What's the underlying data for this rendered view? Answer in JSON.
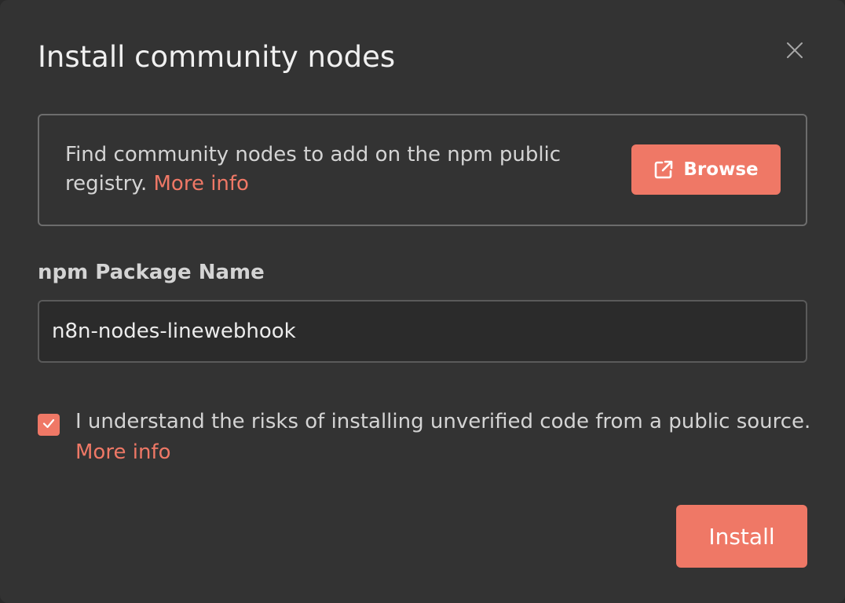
{
  "dialog": {
    "title": "Install community nodes"
  },
  "info": {
    "text": "Find community nodes to add on the npm public registry.",
    "more_info_label": "More info",
    "browse_label": "Browse"
  },
  "package_field": {
    "label": "npm Package Name",
    "value": "n8n-nodes-linewebhook"
  },
  "consent": {
    "checked": true,
    "text": "I understand the risks of installing unverified code from a public source.",
    "more_info_label": "More info"
  },
  "actions": {
    "install_label": "Install"
  },
  "icons": {
    "close": "close-icon",
    "browse": "external-link-icon",
    "checkbox": "check-icon"
  },
  "colors": {
    "accent": "#ef7866",
    "background": "#333333"
  }
}
